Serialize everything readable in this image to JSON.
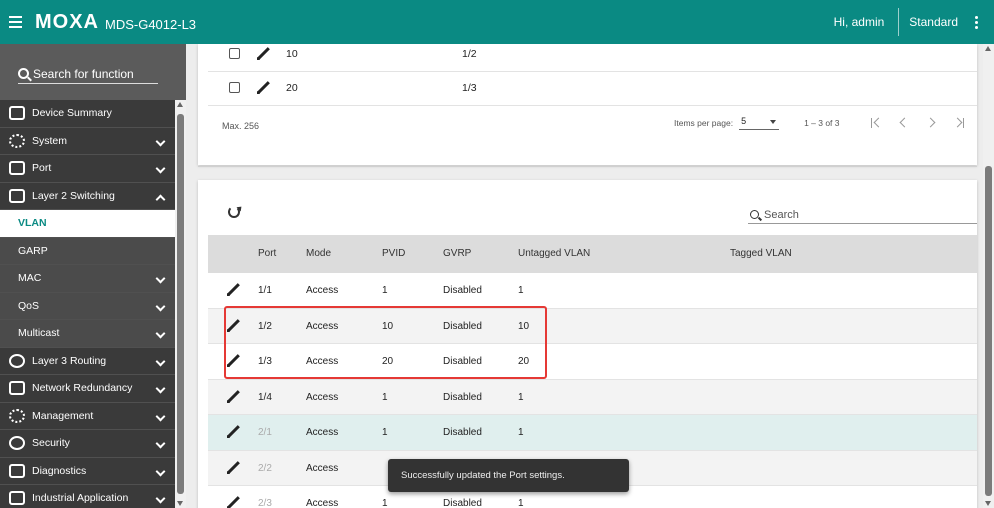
{
  "header": {
    "logo": "MOXA",
    "model": "MDS-G4012-L3",
    "greeting": "Hi, admin",
    "role": "Standard"
  },
  "sidebar": {
    "search_placeholder": "Search for function",
    "items": [
      {
        "label": "Device Summary",
        "icon": "dashboard-icon",
        "expandable": false
      },
      {
        "label": "System",
        "icon": "gear-icon",
        "expandable": true
      },
      {
        "label": "Port",
        "icon": "port-icon",
        "expandable": true
      },
      {
        "label": "Layer 2 Switching",
        "icon": "switch-icon",
        "expandable": true,
        "expanded": true
      },
      {
        "label": "VLAN",
        "active": true
      },
      {
        "label": "GARP"
      },
      {
        "label": "MAC",
        "expandable": true
      },
      {
        "label": "QoS",
        "expandable": true
      },
      {
        "label": "Multicast",
        "expandable": true
      },
      {
        "label": "Layer 3 Routing",
        "icon": "routing-icon",
        "expandable": true
      },
      {
        "label": "Network Redundancy",
        "icon": "redundancy-icon",
        "expandable": true
      },
      {
        "label": "Management",
        "icon": "management-icon",
        "expandable": true
      },
      {
        "label": "Security",
        "icon": "security-icon",
        "expandable": true
      },
      {
        "label": "Diagnostics",
        "icon": "diagnostics-icon",
        "expandable": true
      },
      {
        "label": "Industrial Application",
        "icon": "industrial-icon",
        "expandable": true
      }
    ]
  },
  "vlan_table": {
    "rows": [
      {
        "vid": "10",
        "member_port": "1/2"
      },
      {
        "vid": "20",
        "member_port": "1/3"
      }
    ],
    "max_label": "Max. 256",
    "items_per_page_label": "Items per page:",
    "items_per_page": "5",
    "range": "1 – 3 of 3"
  },
  "port_table": {
    "search_placeholder": "Search",
    "columns": [
      "Port",
      "Mode",
      "PVID",
      "GVRP",
      "Untagged VLAN",
      "Tagged VLAN"
    ],
    "rows": [
      {
        "port": "1/1",
        "mode": "Access",
        "pvid": "1",
        "gvrp": "Disabled",
        "untagged": "1",
        "tagged": ""
      },
      {
        "port": "1/2",
        "mode": "Access",
        "pvid": "10",
        "gvrp": "Disabled",
        "untagged": "10",
        "tagged": ""
      },
      {
        "port": "1/3",
        "mode": "Access",
        "pvid": "20",
        "gvrp": "Disabled",
        "untagged": "20",
        "tagged": ""
      },
      {
        "port": "1/4",
        "mode": "Access",
        "pvid": "1",
        "gvrp": "Disabled",
        "untagged": "1",
        "tagged": ""
      },
      {
        "port": "2/1",
        "mode": "Access",
        "pvid": "1",
        "gvrp": "Disabled",
        "untagged": "1",
        "tagged": ""
      },
      {
        "port": "2/2",
        "mode": "Access",
        "pvid": "",
        "gvrp": "",
        "untagged": "",
        "tagged": ""
      },
      {
        "port": "2/3",
        "mode": "Access",
        "pvid": "1",
        "gvrp": "Disabled",
        "untagged": "1",
        "tagged": ""
      }
    ]
  },
  "toast": {
    "message": "Successfully updated the Port settings."
  },
  "colors": {
    "brand": "#0a8a83",
    "highlight_box": "#e53935"
  }
}
